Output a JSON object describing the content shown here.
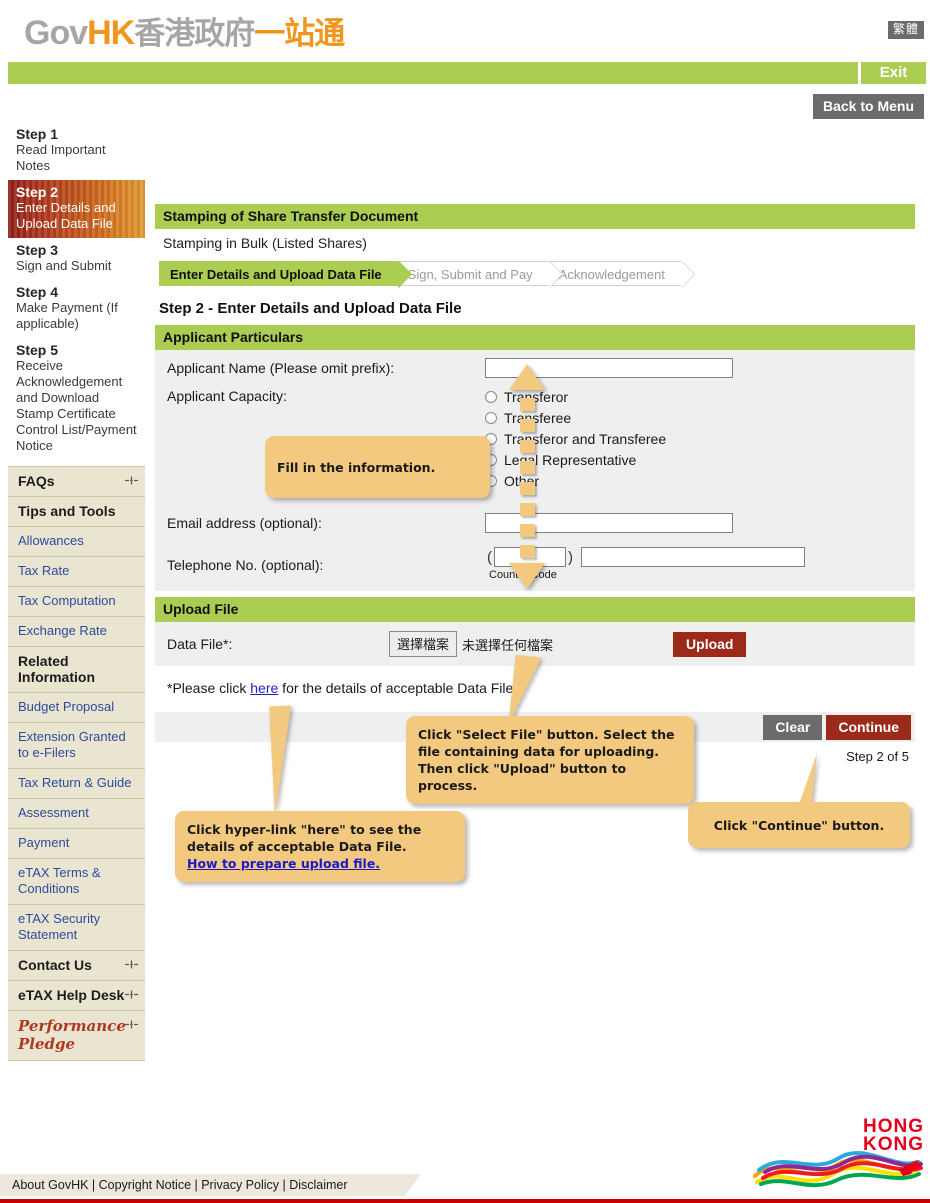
{
  "brand": {
    "gov": "Gov",
    "hk": "HK",
    "cn_gray": "香港政府",
    "cn_orange": "一站通",
    "language_toggle": "繁體"
  },
  "topnav": {
    "exit_label": "Exit",
    "back_to_menu_label": "Back to Menu"
  },
  "sidebar": {
    "steps": [
      {
        "title": "Step 1",
        "desc": "Read Important Notes",
        "active": false
      },
      {
        "title": "Step 2",
        "desc": "Enter Details and Upload Data File",
        "active": true
      },
      {
        "title": "Step 3",
        "desc": "Sign and Submit",
        "active": false
      },
      {
        "title": "Step 4",
        "desc": "Make Payment (If applicable)",
        "active": false
      },
      {
        "title": "Step 5",
        "desc": "Receive Acknowledgement and Download Stamp Certificate Control List/Payment Notice",
        "active": false
      }
    ],
    "nav": [
      {
        "label": "FAQs",
        "type": "head",
        "expand": true
      },
      {
        "label": "Tips and Tools",
        "type": "head",
        "expand": false
      },
      {
        "label": "Allowances",
        "type": "link"
      },
      {
        "label": "Tax Rate",
        "type": "link"
      },
      {
        "label": "Tax Computation",
        "type": "link"
      },
      {
        "label": "Exchange Rate",
        "type": "link"
      },
      {
        "label": "Related Information",
        "type": "head",
        "expand": false
      },
      {
        "label": "Budget Proposal",
        "type": "link"
      },
      {
        "label": "Extension Granted to e-Filers",
        "type": "link"
      },
      {
        "label": "Tax Return & Guide",
        "type": "link"
      },
      {
        "label": "Assessment",
        "type": "link"
      },
      {
        "label": "Payment",
        "type": "link"
      },
      {
        "label": "eTAX Terms & Conditions",
        "type": "link"
      },
      {
        "label": "eTAX Security Statement",
        "type": "link"
      },
      {
        "label": "Contact Us",
        "type": "head",
        "expand": true
      },
      {
        "label": "eTAX Help Desk",
        "type": "head",
        "expand": true
      },
      {
        "label": "Performance Pledge",
        "type": "pledge",
        "expand": true
      }
    ]
  },
  "main": {
    "section_title": "Stamping of Share Transfer Document",
    "subtitle": "Stamping in Bulk (Listed Shares)",
    "tabs": [
      {
        "label": "Enter Details and Upload Data File",
        "active": true
      },
      {
        "label": "Sign, Submit and Pay",
        "active": false
      },
      {
        "label": "Acknowledgement",
        "active": false
      }
    ],
    "step_title": "Step 2 - Enter Details and Upload Data File",
    "applicant": {
      "header": "Applicant Particulars",
      "name_label": "Applicant Name (Please omit prefix):",
      "name_value": "",
      "capacity_label": "Applicant Capacity:",
      "capacity_options": [
        "Transferor",
        "Transferee",
        "Transferor and Transferee",
        "Legal Representative",
        "Other"
      ],
      "email_label": "Email address (optional):",
      "email_value": "",
      "phone_label": "Telephone No. (optional):",
      "country_code_value": "",
      "country_code_caption": "Country Code",
      "phone_value": ""
    },
    "upload": {
      "header": "Upload File",
      "data_file_label": "Data File*:",
      "select_file_button": "選擇檔案",
      "no_file_text": "未選擇任何檔案",
      "upload_button": "Upload"
    },
    "note_prefix": "*Please click ",
    "note_link": "here",
    "note_suffix": " for the details of acceptable Data File.",
    "clear_label": "Clear",
    "continue_label": "Continue",
    "step_of": "Step 2 of 5"
  },
  "callouts": {
    "fill_info": "Fill in the information.",
    "select_file": "Click \"Select File\" button. Select the file containing data for uploading. Then click \"Upload\" button to process.",
    "hyperlink_line1": "Click hyper-link \"here\" to see the",
    "hyperlink_line2": "details of acceptable Data File.",
    "hyperlink_link": "How to prepare upload file.",
    "continue_hint": "Click \"Continue\" button."
  },
  "footer": {
    "links": "About GovHK | Copyright Notice | Privacy Policy | Disclaimer",
    "hk_line1": "HONG",
    "hk_line2": "KONG"
  },
  "colors": {
    "green": "#aacd52",
    "dark_red": "#9c2a1b",
    "gray_button": "#6b6b6b",
    "callout": "#f3c97f",
    "sidebar_bg": "#e9e5d0",
    "brand_red": "#e3001b"
  }
}
